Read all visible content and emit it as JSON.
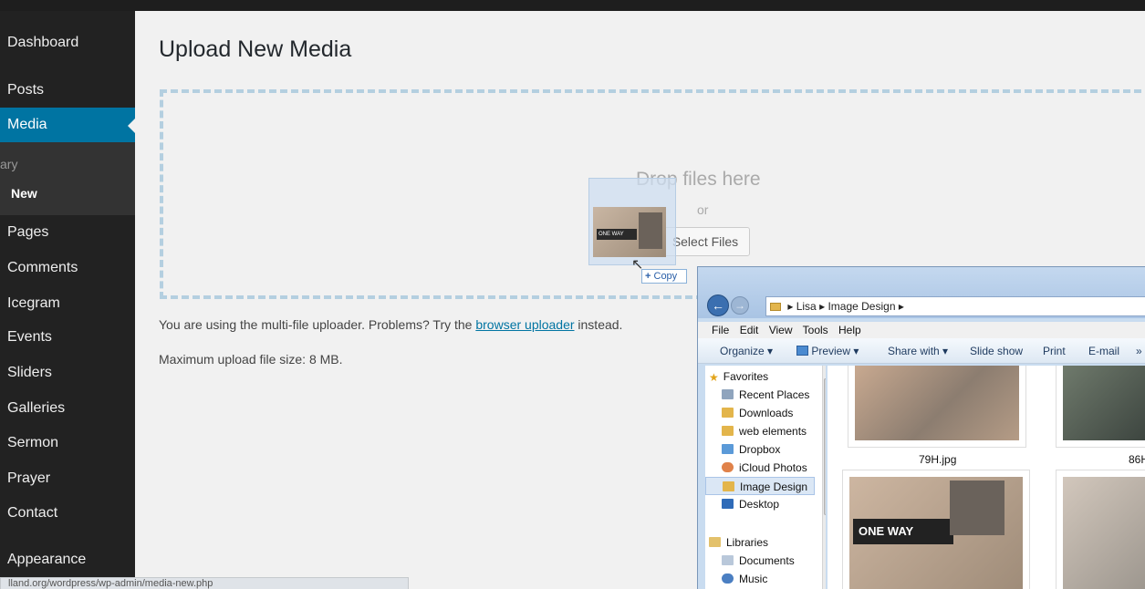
{
  "sidebar": {
    "items": [
      {
        "key": "dashboard",
        "label": "Dashboard"
      },
      {
        "key": "posts",
        "label": "Posts"
      },
      {
        "key": "media",
        "label": "Media",
        "active": true
      },
      {
        "key": "pages",
        "label": "Pages"
      },
      {
        "key": "comments",
        "label": "Comments"
      },
      {
        "key": "icegram",
        "label": "Icegram"
      },
      {
        "key": "events",
        "label": "Events"
      },
      {
        "key": "sliders",
        "label": "Sliders"
      },
      {
        "key": "galleries",
        "label": "Galleries"
      },
      {
        "key": "sermon",
        "label": "Sermon"
      },
      {
        "key": "prayer",
        "label": "Prayer"
      },
      {
        "key": "contact",
        "label": "Contact"
      },
      {
        "key": "appearance",
        "label": "Appearance"
      }
    ],
    "submenu": {
      "library": "ary",
      "add_new": "New"
    }
  },
  "status_url": "lland.org/wordpress/wp-admin/media-new.php",
  "main": {
    "title": "Upload New Media",
    "drop_text": "Drop files here",
    "or_text": "or",
    "select_files": "Select Files",
    "uploader_info_prefix": "You are using the multi-file uploader. Problems? Try the ",
    "uploader_link": "browser uploader",
    "uploader_info_suffix": " instead.",
    "max_size": "Maximum upload file size: 8 MB.",
    "drag_tooltip": "Copy",
    "drag_thumb_sign": "ONE WAY"
  },
  "explorer": {
    "breadcrumb": [
      "Lisa",
      "Image Design"
    ],
    "menu": [
      "File",
      "Edit",
      "View",
      "Tools",
      "Help"
    ],
    "toolbar": {
      "organize": "Organize",
      "preview": "Preview",
      "share": "Share with",
      "slideshow": "Slide show",
      "print": "Print",
      "email": "E-mail",
      "more": "»"
    },
    "nav": [
      {
        "label": "Favorites",
        "icon": "star-icon"
      },
      {
        "label": "Recent Places",
        "icon": "recent-places-icon"
      },
      {
        "label": "Downloads",
        "icon": "downloads-folder-icon"
      },
      {
        "label": "web elements",
        "icon": "folder-icon"
      },
      {
        "label": "Dropbox",
        "icon": "dropbox-folder-icon"
      },
      {
        "label": "iCloud Photos",
        "icon": "icloud-photos-icon"
      },
      {
        "label": "Image Design",
        "icon": "folder-icon",
        "selected": true
      },
      {
        "label": "Desktop",
        "icon": "desktop-icon"
      },
      {
        "label": "Libraries",
        "icon": "libraries-icon"
      },
      {
        "label": "Documents",
        "icon": "documents-icon"
      },
      {
        "label": "Music",
        "icon": "music-icon"
      }
    ],
    "files": [
      {
        "label": "79H.jpg"
      },
      {
        "label": "86H"
      },
      {
        "label": "",
        "sign": "ONE WAY"
      },
      {
        "label": ""
      }
    ]
  },
  "colors": {
    "sidebar_bg": "#222222",
    "active_menu": "#0074a2",
    "dropzone_border": "#b4cfe0",
    "link": "#0074a2"
  }
}
